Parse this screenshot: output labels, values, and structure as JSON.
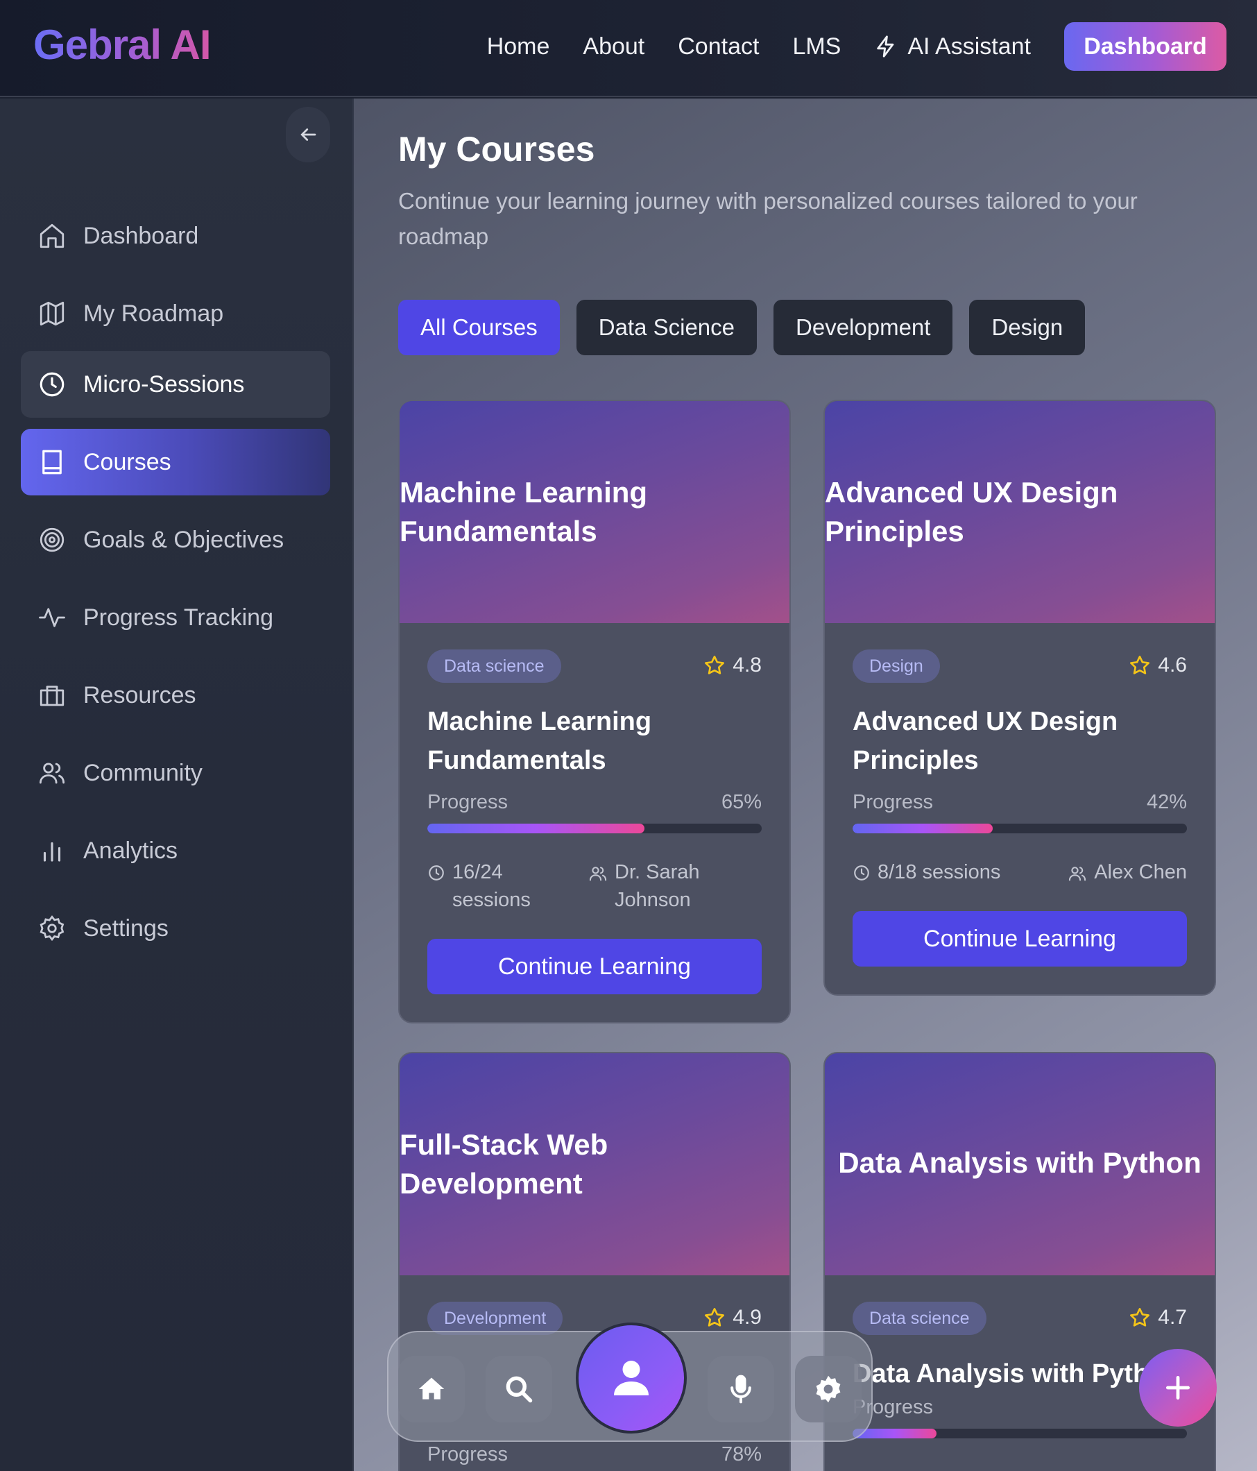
{
  "header": {
    "logo": "Gebral AI",
    "nav": [
      "Home",
      "About",
      "Contact",
      "LMS"
    ],
    "ai_assistant": "AI Assistant",
    "dashboard_button": "Dashboard"
  },
  "sidebar": {
    "collapse_icon": "arrow-left-icon",
    "items": [
      {
        "label": "Dashboard",
        "icon": "home-icon",
        "state": "normal"
      },
      {
        "label": "My Roadmap",
        "icon": "map-icon",
        "state": "normal"
      },
      {
        "label": "Micro-Sessions",
        "icon": "clock-icon",
        "state": "hover"
      },
      {
        "label": "Courses",
        "icon": "book-icon",
        "state": "active"
      },
      {
        "label": "Goals & Objectives",
        "icon": "target-icon",
        "state": "normal"
      },
      {
        "label": "Progress Tracking",
        "icon": "activity-icon",
        "state": "normal"
      },
      {
        "label": "Resources",
        "icon": "briefcase-icon",
        "state": "normal"
      },
      {
        "label": "Community",
        "icon": "users-icon",
        "state": "normal"
      },
      {
        "label": "Analytics",
        "icon": "bar-chart-icon",
        "state": "normal"
      },
      {
        "label": "Settings",
        "icon": "gear-icon",
        "state": "normal"
      }
    ]
  },
  "main": {
    "title": "My Courses",
    "subtitle": "Continue your learning journey with personalized courses tailored to your roadmap",
    "filters": [
      "All Courses",
      "Data Science",
      "Development",
      "Design"
    ],
    "active_filter": "All Courses",
    "courses": [
      {
        "header_title": "Machine Learning Fundamentals",
        "category": "Data science",
        "rating": "4.8",
        "name": "Machine Learning Fundamentals",
        "progress_label": "Progress",
        "progress_text": "65%",
        "progress": 0.65,
        "sessions": "16/24 sessions",
        "instructor": "Dr. Sarah Johnson",
        "button": "Continue Learning"
      },
      {
        "header_title": "Advanced UX Design Principles",
        "category": "Design",
        "rating": "4.6",
        "name": "Advanced UX Design Principles",
        "progress_label": "Progress",
        "progress_text": "42%",
        "progress": 0.42,
        "sessions": "8/18 sessions",
        "instructor": "Alex Chen",
        "button": "Continue Learning"
      },
      {
        "header_title": "Full-Stack Web Development",
        "category": "Development",
        "rating": "4.9",
        "name": "",
        "progress_label": "Progress",
        "progress_text": "78%",
        "progress": 0.78
      },
      {
        "header_title": "Data Analysis with Python",
        "category": "Data science",
        "rating": "4.7",
        "name": "Data Analysis with Python",
        "progress_label": "Progress",
        "progress": 0.25
      }
    ]
  },
  "dock": {
    "icons": [
      "home-icon",
      "search-icon",
      "user-icon",
      "microphone-icon",
      "gear-icon"
    ]
  },
  "fab_icon": "plus-icon",
  "colors": {
    "accent": "#4f46e5",
    "brand_gradient_start": "#6366f1",
    "brand_gradient_end": "#ec4899",
    "star": "#f5c518"
  }
}
